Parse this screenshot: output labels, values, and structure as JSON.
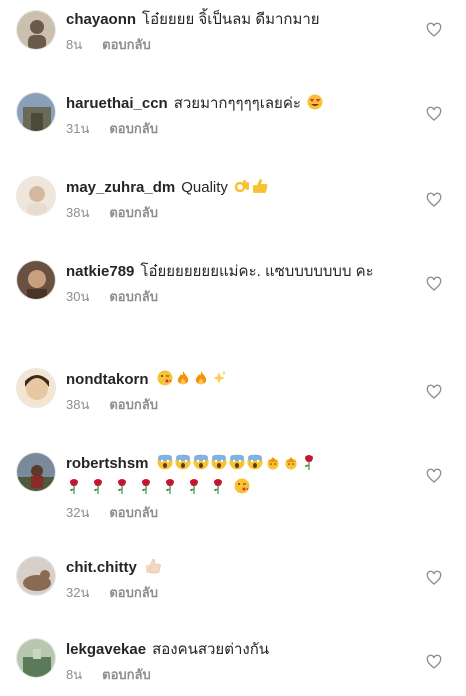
{
  "reply_label": "ตอบกลับ",
  "comments": [
    {
      "username": "chayaonn",
      "text": "โอ๋ยยยย จิ้เป็นลม ดีมากมาย",
      "time": "8น",
      "avatar_colors": [
        "#cbbfae",
        "#6a5a4a"
      ]
    },
    {
      "username": "haruethai_ccn",
      "text": "สวยมากๆๆๆๆเลยค่ะ",
      "emojis": [
        "heart-eyes"
      ],
      "time": "31น",
      "avatar_colors": [
        "#8aa0b8",
        "#6a6a5a"
      ]
    },
    {
      "username": "may_zuhra_dm",
      "text": "Quality",
      "emojis": [
        "ok-hand",
        "thumbs-up"
      ],
      "time": "38น",
      "avatar_colors": [
        "#f0e6dc",
        "#d6b8a0"
      ]
    },
    {
      "username": "natkie789",
      "text": "โอ๋ยยยยยยยแม่คะ. แซบบบบบบบ คะ",
      "time": "30น",
      "avatar_colors": [
        "#6a5040",
        "#c8a080"
      ]
    },
    {
      "username": "nondtakorn",
      "text": "",
      "emojis": [
        "kiss",
        "fire",
        "fire",
        "sparkles"
      ],
      "time": "38น",
      "avatar_colors": [
        "#e8c8a0",
        "#b07050"
      ]
    },
    {
      "username": "robertshsm",
      "text": "",
      "emojis": [
        "scream",
        "scream",
        "scream",
        "scream",
        "scream",
        "scream",
        "princess",
        "princess",
        "rose",
        "rose",
        "rose",
        "rose",
        "rose",
        "rose",
        "rose",
        "rose",
        "kiss"
      ],
      "time": "32น",
      "avatar_colors": [
        "#7a8a9a",
        "#5a3a2a"
      ]
    },
    {
      "username": "chit.chitty",
      "text": "",
      "emojis": [
        "thumbs-up-light"
      ],
      "time": "32น",
      "avatar_colors": [
        "#d8d0c8",
        "#8a6a50"
      ]
    },
    {
      "username": "lekgavekae",
      "text": "สองคนสวยต่างกัน",
      "time": "8น",
      "avatar_colors": [
        "#b8c8b0",
        "#5a7a5a"
      ]
    }
  ]
}
